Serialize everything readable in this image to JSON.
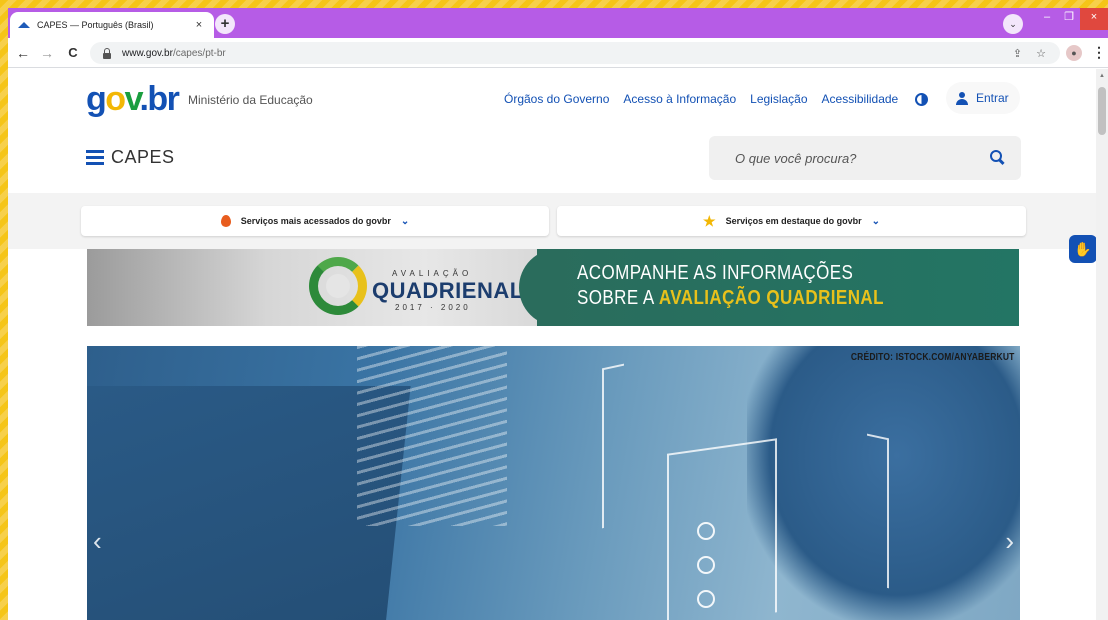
{
  "browser": {
    "tab_title": "CAPES — Português (Brasil)",
    "tab_close": "×",
    "new_tab": "+",
    "url_host": "www.gov.br",
    "url_path": "/capes/pt-br",
    "tab_search": "⌄",
    "minimize": "–",
    "maximize": "❐",
    "close": "×",
    "back": "←",
    "forward": "→",
    "reload": "C",
    "share_icon": "⇪",
    "bookmark_icon": "☆",
    "profile_icon": "●",
    "menu_icon": "⋮",
    "theme_color": "#b65ce6"
  },
  "header": {
    "logo": {
      "g": "g",
      "o": "o",
      "v": "v",
      "dot": ".",
      "br": "br"
    },
    "ministry": "Ministério da Educação",
    "nav": [
      "Órgãos do Governo",
      "Acesso à Informação",
      "Legislação",
      "Acessibilidade"
    ],
    "login_label": "Entrar",
    "site_title": "CAPES",
    "search_placeholder": "O que você procura?",
    "brand_color": "#1351b4"
  },
  "services": {
    "most_accessed": "Serviços mais acessados do govbr",
    "featured": "Serviços em destaque do govbr",
    "chevron": "⌄",
    "star": "★"
  },
  "banner": {
    "avaliacao": "AVALIAÇÃO",
    "quadrienal": "QUADRIENAL",
    "years": "2017 · 2020",
    "line1": "ACOMPANHE AS INFORMAÇÕES",
    "line2_prefix": "SOBRE A ",
    "line2_highlight": "AVALIAÇÃO QUADRIENAL"
  },
  "hero": {
    "credit": "CRÉDITO: ISTOCK.COM/ANYABERKUT",
    "prev": "‹",
    "next": "›"
  },
  "vlibras_icon": "✋"
}
